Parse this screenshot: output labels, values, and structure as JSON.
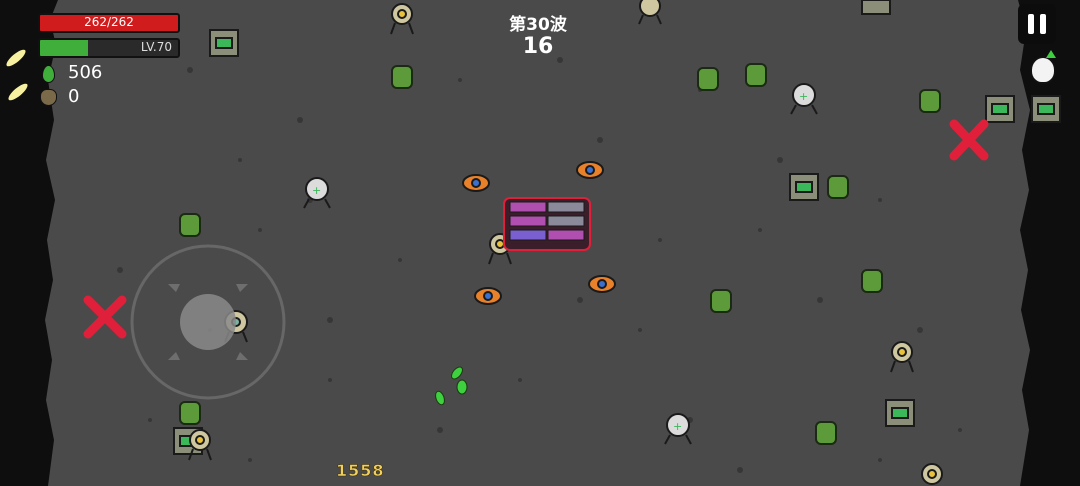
{
  "hud": {
    "hp_text": "262/262",
    "hp_fraction": 1.0,
    "level_text": "LV.70",
    "xp_fraction": 0.35,
    "materials_count": "506",
    "bag_count": "0",
    "wave_label": "第30波",
    "wave_timer": "16",
    "damage_number": "1558"
  },
  "icons": {
    "material": "green-gem-icon",
    "bag": "loot-bag-icon",
    "pause": "pause-icon",
    "level_up": "egg-levelup-icon",
    "crate": "crate-icon"
  },
  "colors": {
    "arena": "#4a4a4a",
    "border": "#0e0e0e",
    "hp": "#d01c1c",
    "xp": "#3fae3a",
    "damage_text": "#f0d060",
    "enemy_green": "#5c9a3a",
    "player_red": "#e0203a",
    "orange_enemy": "#e8812a"
  }
}
